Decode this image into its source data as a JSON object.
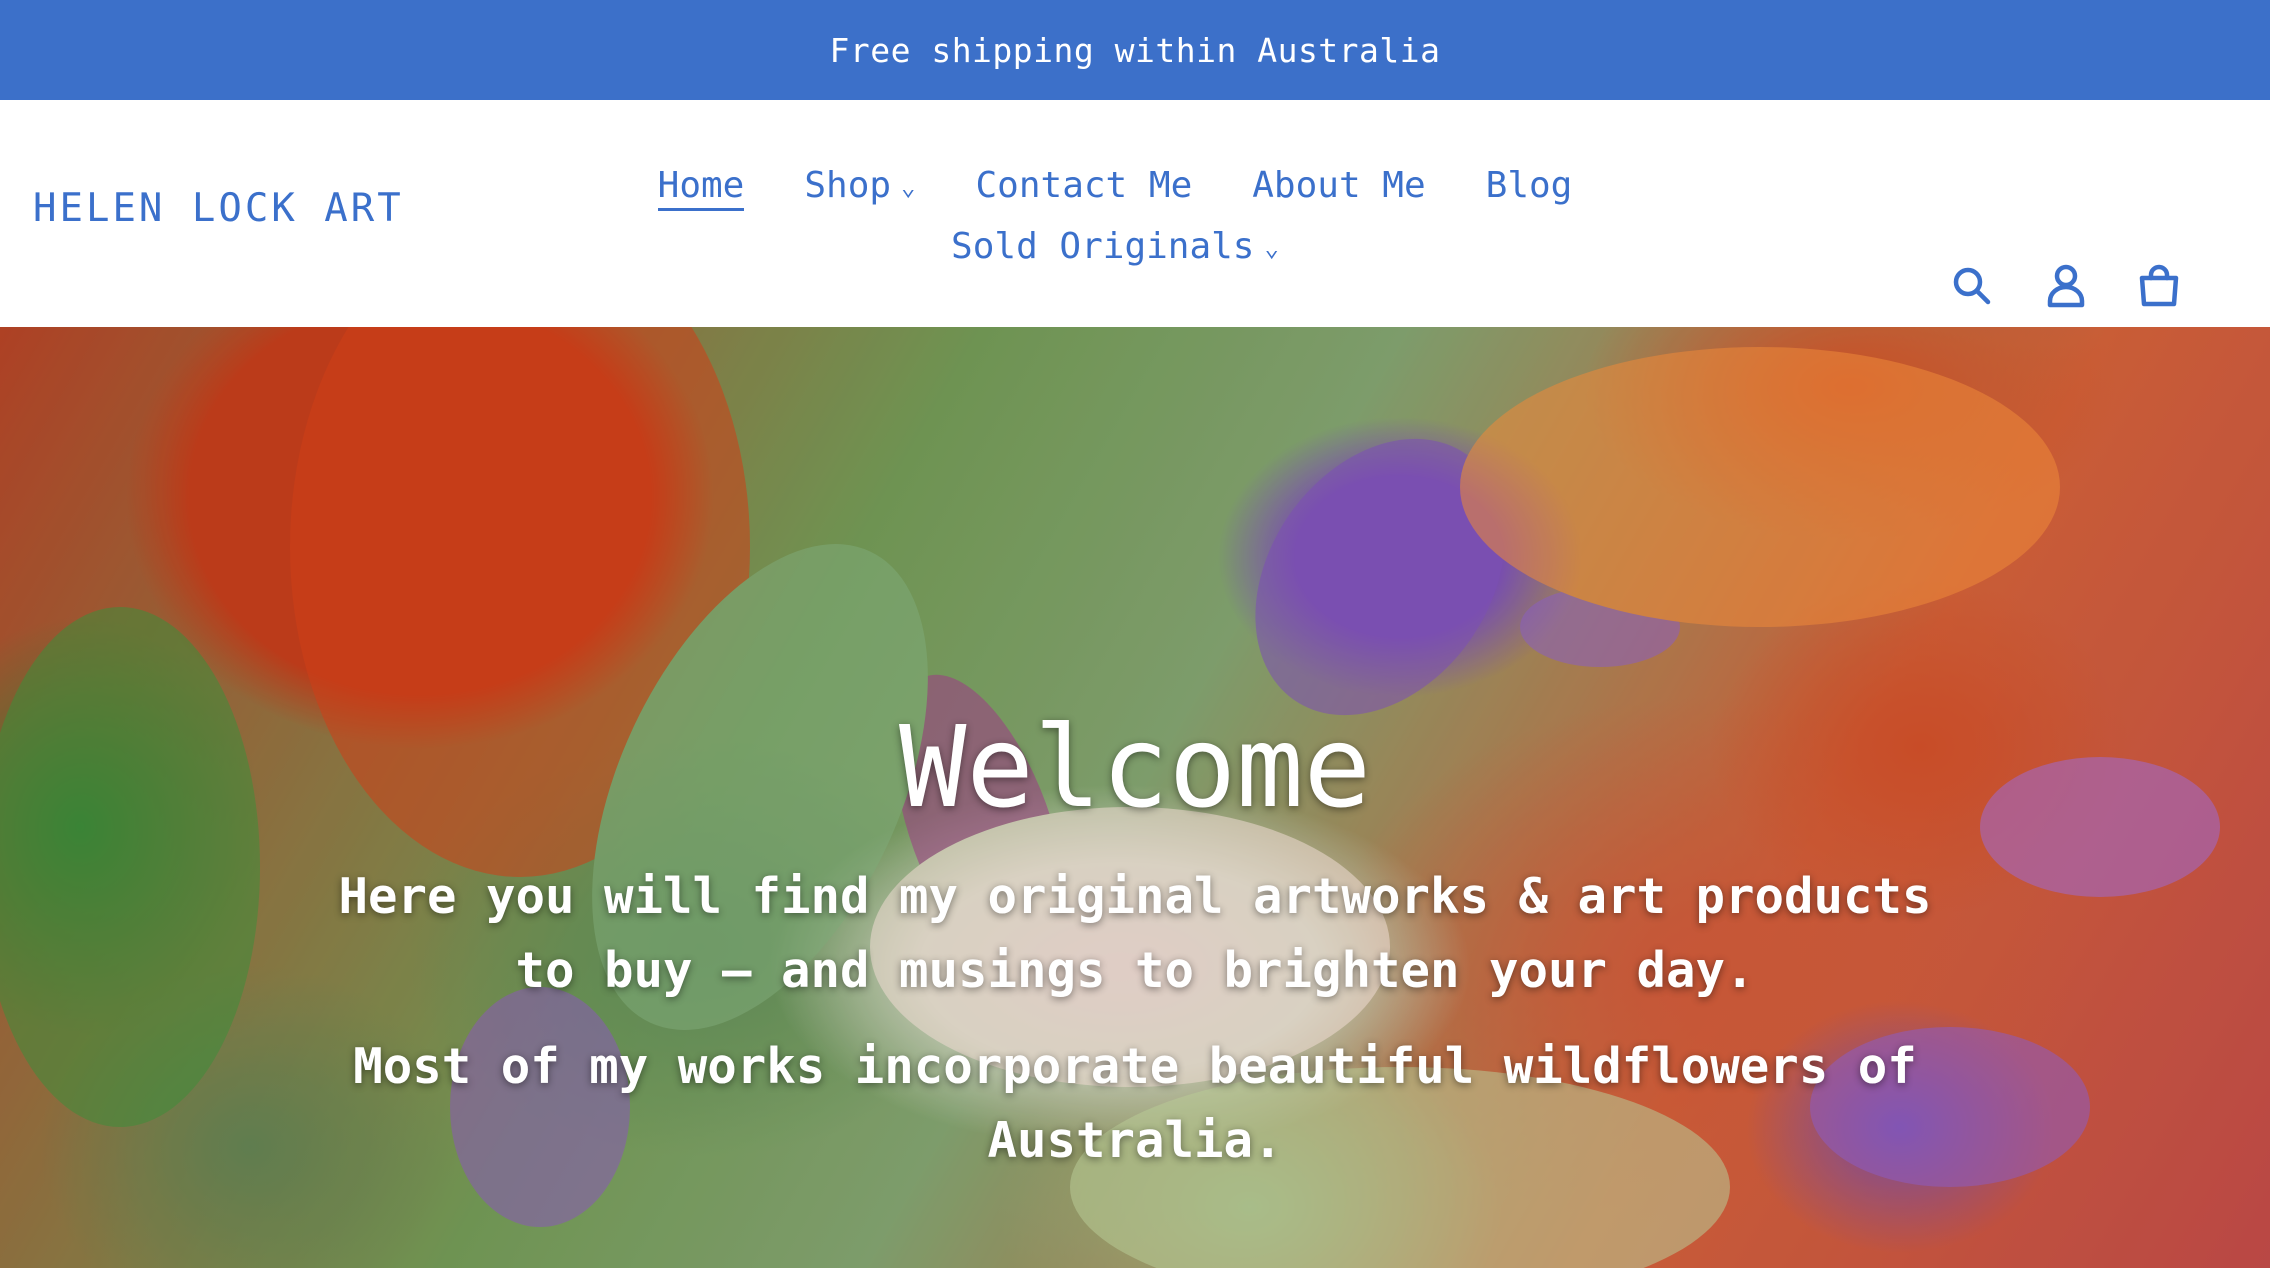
{
  "announcement": "Free shipping within Australia",
  "header": {
    "logo": "HELEN LOCK ART",
    "nav": [
      {
        "label": "Home",
        "active": true,
        "dropdown": false
      },
      {
        "label": "Shop",
        "active": false,
        "dropdown": true
      },
      {
        "label": "Contact Me",
        "active": false,
        "dropdown": false
      },
      {
        "label": "About Me",
        "active": false,
        "dropdown": false
      },
      {
        "label": "Blog",
        "active": false,
        "dropdown": false
      },
      {
        "label": "Sold Originals",
        "active": false,
        "dropdown": true
      }
    ],
    "icons": [
      "search-icon",
      "account-icon",
      "cart-icon"
    ]
  },
  "hero": {
    "title": "Welcome",
    "text1": "Here you will find my original artworks & art products to buy – and musings to brighten your day.",
    "text2": "Most of my works incorporate beautiful wildflowers of Australia."
  },
  "colors": {
    "accent": "#3b70cb",
    "announcement_bg": "#3c70c9"
  }
}
